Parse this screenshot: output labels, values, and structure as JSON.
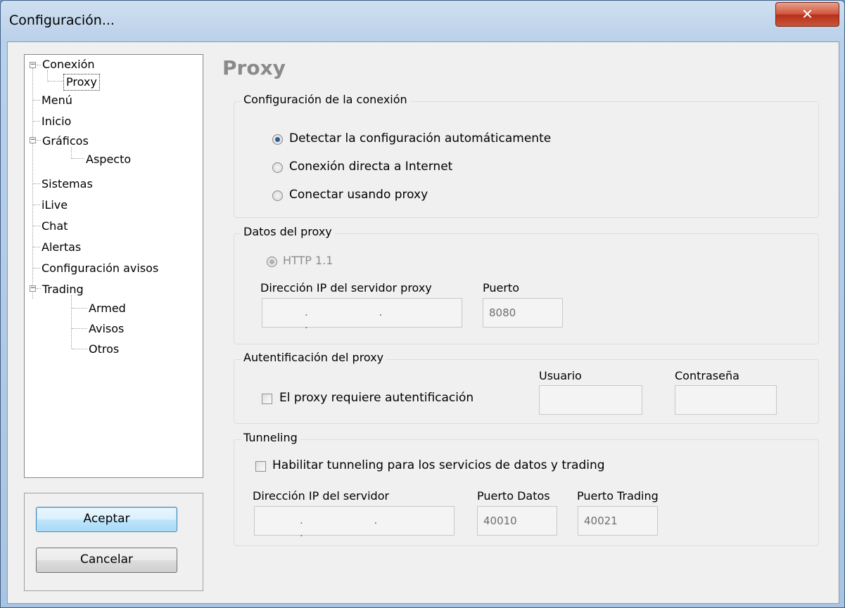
{
  "window": {
    "title": "Configuración...",
    "close_glyph": "✕"
  },
  "tree": {
    "nodes": [
      {
        "label": "Conexión"
      },
      {
        "label": "Proxy"
      },
      {
        "label": "Menú"
      },
      {
        "label": "Inicio"
      },
      {
        "label": "Gráficos"
      },
      {
        "label": "Aspecto"
      },
      {
        "label": "Sistemas"
      },
      {
        "label": "iLive"
      },
      {
        "label": "Chat"
      },
      {
        "label": "Alertas"
      },
      {
        "label": "Configuración avisos"
      },
      {
        "label": "Trading"
      },
      {
        "label": "Armed"
      },
      {
        "label": "Avisos"
      },
      {
        "label": "Otros"
      }
    ],
    "expander_glyph": "−"
  },
  "buttons": {
    "accept": "Aceptar",
    "cancel": "Cancelar"
  },
  "page": {
    "heading": "Proxy",
    "connection": {
      "label": "Configuración de la conexión",
      "options": [
        {
          "label": "Detectar la configuración automáticamente",
          "selected": true
        },
        {
          "label": "Conexión directa a Internet",
          "selected": false
        },
        {
          "label": "Conectar usando proxy",
          "selected": false
        }
      ]
    },
    "proxy_data": {
      "label": "Datos del proxy",
      "protocol": "HTTP 1.1",
      "ip_label": "Dirección IP del servidor proxy",
      "ip_value": ". . .",
      "port_label": "Puerto",
      "port_value": "8080"
    },
    "auth": {
      "label": "Autentificación del proxy",
      "checkbox": "El proxy requiere autentificación",
      "user_label": "Usuario",
      "password_label": "Contraseña"
    },
    "tunneling": {
      "label": "Tunneling",
      "checkbox": "Habilitar tunneling para los servicios de datos y trading",
      "ip_label": "Dirección IP del servidor",
      "ip_value": ". . .",
      "data_port_label": "Puerto Datos",
      "data_port_value": "40010",
      "trading_port_label": "Puerto Trading",
      "trading_port_value": "40021"
    }
  }
}
